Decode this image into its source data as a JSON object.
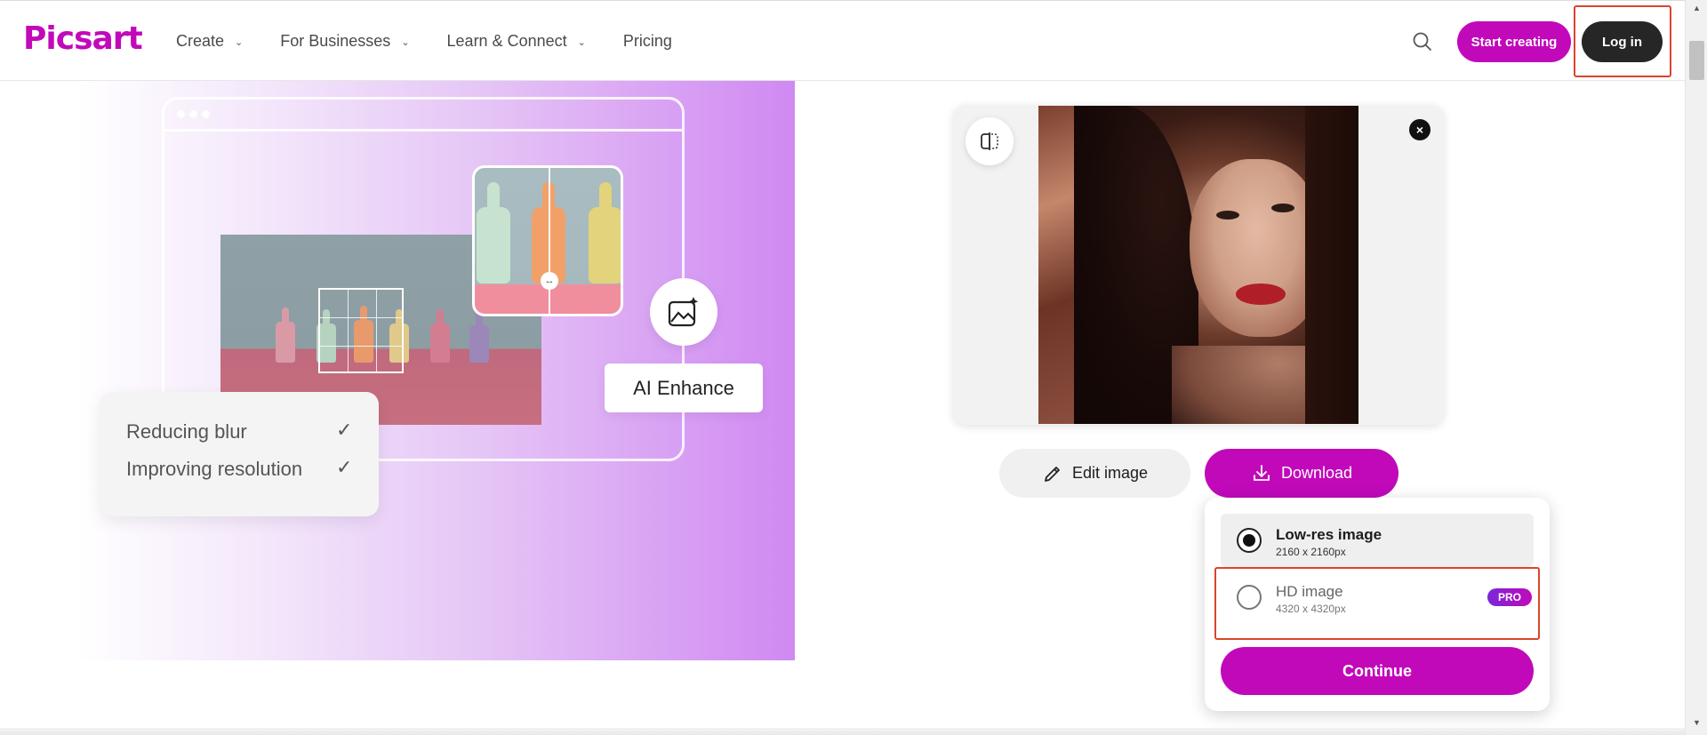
{
  "header": {
    "logo": "Picsart",
    "nav": [
      {
        "label": "Create",
        "has_dropdown": true
      },
      {
        "label": "For Businesses",
        "has_dropdown": true
      },
      {
        "label": "Learn & Connect",
        "has_dropdown": true
      },
      {
        "label": "Pricing",
        "has_dropdown": false
      }
    ],
    "search_icon": "search-icon",
    "start_creating_label": "Start creating",
    "login_label": "Log in"
  },
  "hero": {
    "enhance_label": "AI Enhance",
    "checklist": [
      {
        "label": "Reducing blur"
      },
      {
        "label": "Improving resolution"
      }
    ]
  },
  "preview": {
    "compare_icon": "compare-icon",
    "close_icon": "close-icon",
    "edit_label": "Edit image",
    "download_label": "Download"
  },
  "download_menu": {
    "options": [
      {
        "title": "Low-res image",
        "size": "2160 x 2160px",
        "selected": true
      },
      {
        "title": "HD image",
        "size": "4320 x 4320px",
        "selected": false,
        "badge": "PRO"
      }
    ],
    "continue_label": "Continue"
  },
  "colors": {
    "brand": "#c109ba",
    "dark_button": "#262626",
    "highlight": "#d9452b"
  }
}
